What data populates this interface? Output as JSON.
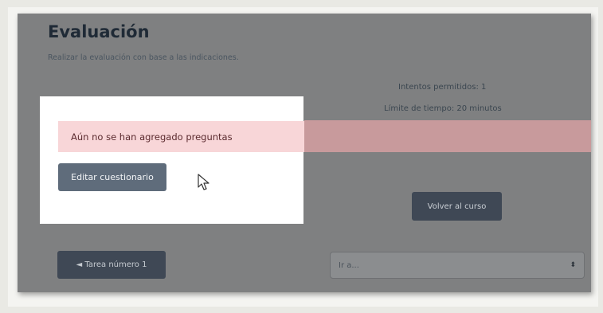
{
  "page": {
    "title": "Evaluación",
    "subtitle": "Realizar la evaluación con base a las indicaciones."
  },
  "quiz_info": {
    "attempts": "Intentos permitidos: 1",
    "time_limit": "Límite de tiempo: 20 minutos"
  },
  "alert": {
    "message": "Aún no se han agregado preguntas"
  },
  "buttons": {
    "edit_quiz": "Editar cuestionario",
    "back_to_course": "Volver al curso",
    "previous_activity": "◄ Tarea número 1"
  },
  "jump_select": {
    "value": "Ir a...",
    "arrow": "⬍"
  },
  "icons": {
    "cursor": "mouse-pointer-icon"
  },
  "colors": {
    "overlay": "#7f8081",
    "alert_bg": "#f8d6d8",
    "button_bg": "#5f6c7b"
  }
}
